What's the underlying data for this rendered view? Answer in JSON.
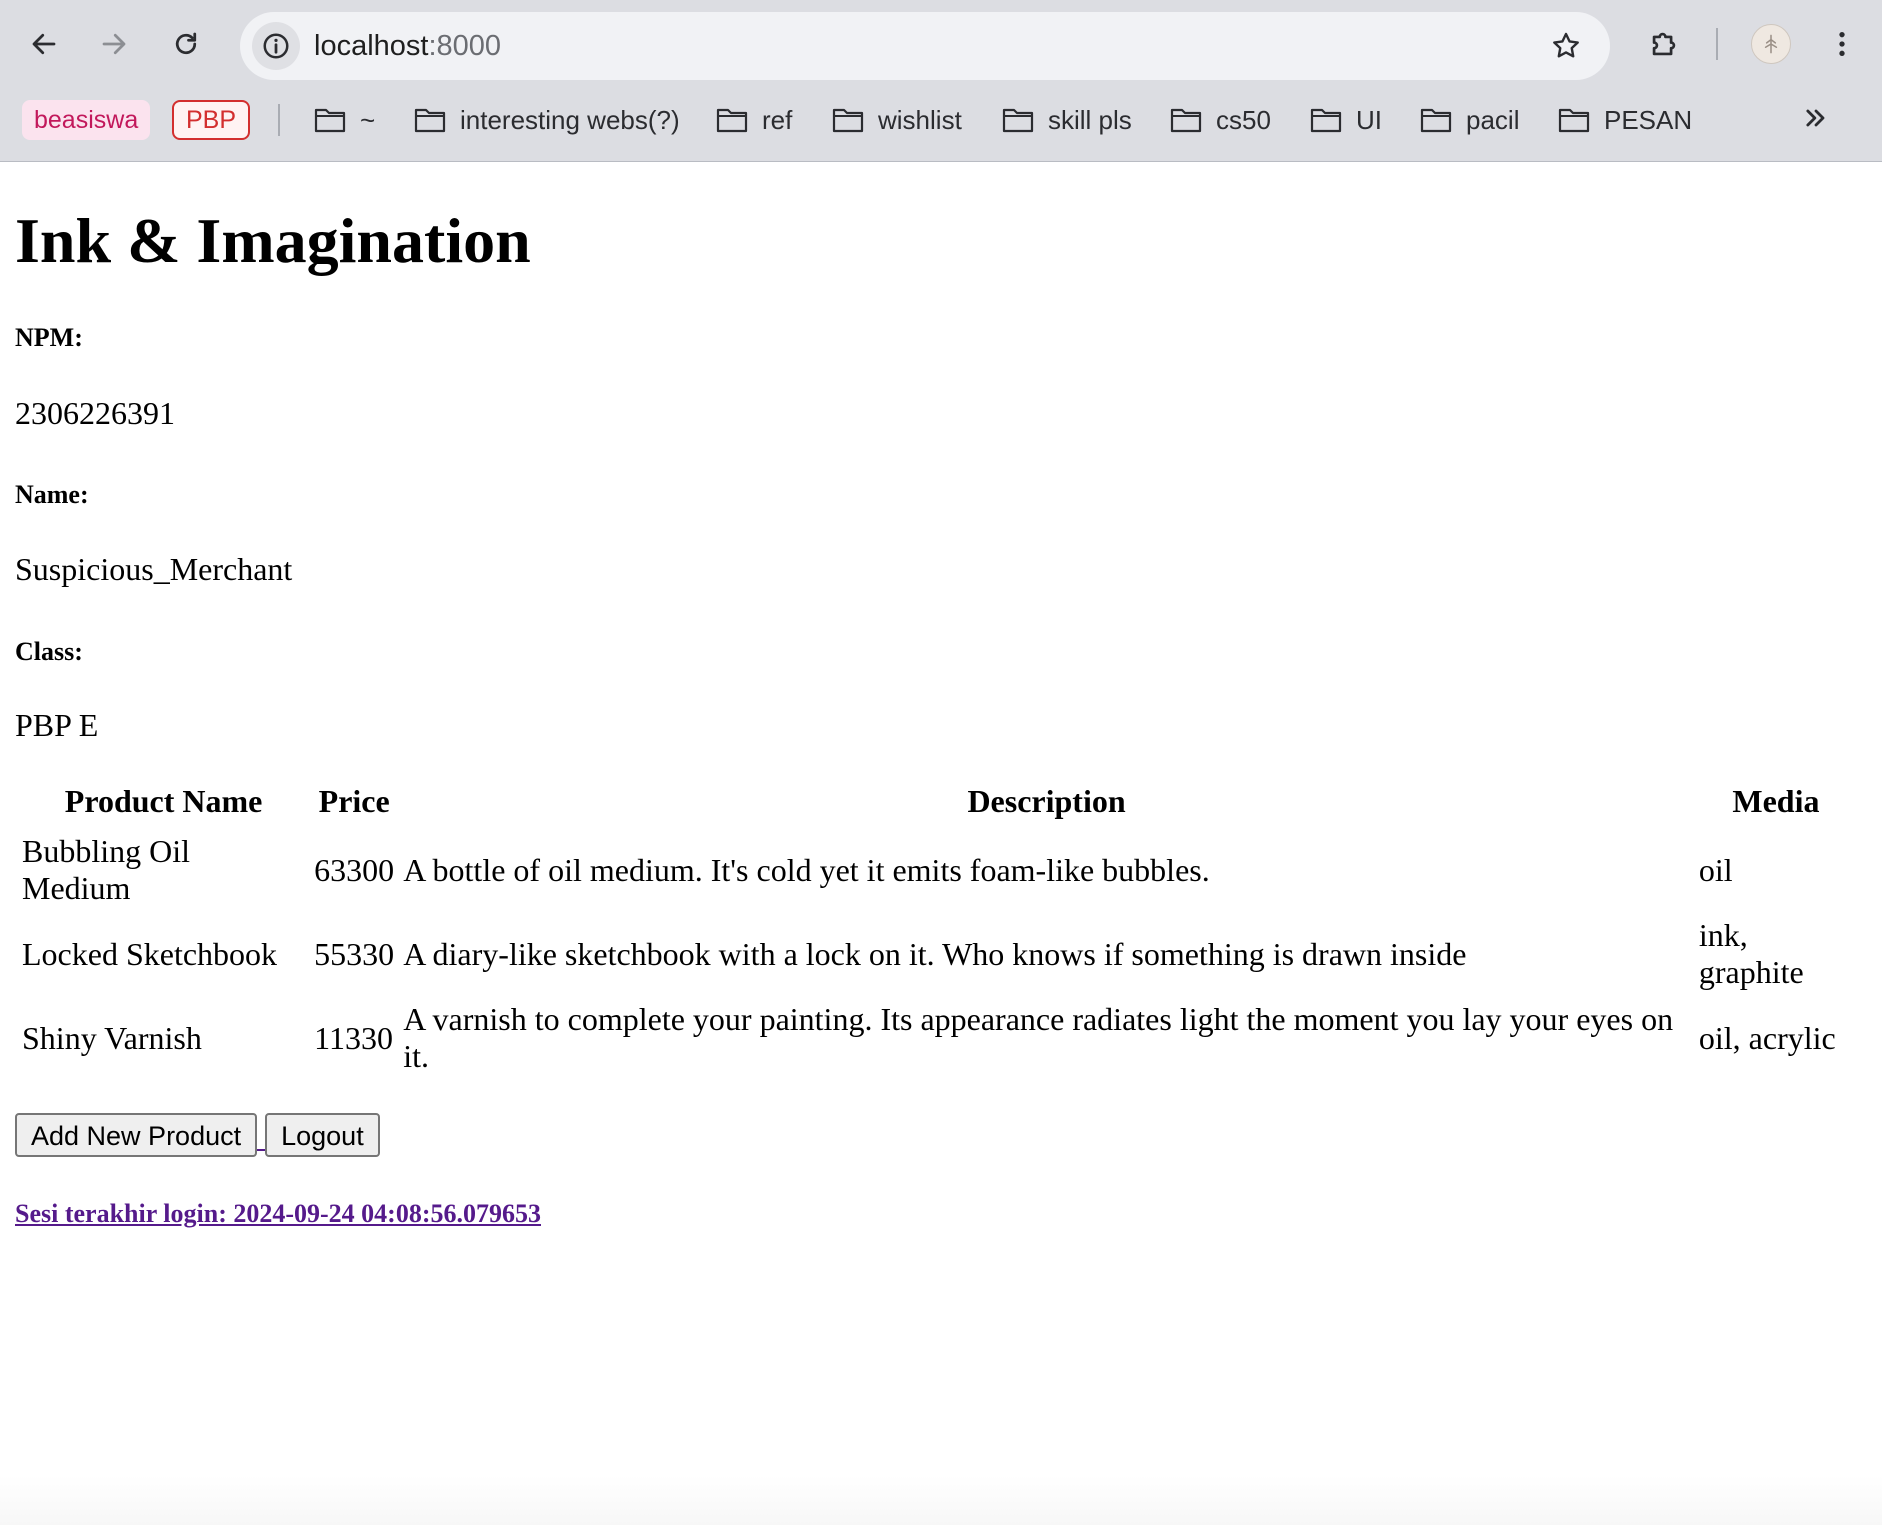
{
  "browser": {
    "url_host": "localhost",
    "url_port": ":8000",
    "bookmarks": {
      "chips": [
        {
          "label": "beasiswa",
          "color": "#c2185b"
        },
        {
          "label": "PBP",
          "color": "#d32f2f"
        }
      ],
      "folders": [
        {
          "label": "~"
        },
        {
          "label": "interesting webs(?)"
        },
        {
          "label": "ref"
        },
        {
          "label": "wishlist"
        },
        {
          "label": "skill pls"
        },
        {
          "label": "cs50"
        },
        {
          "label": "UI"
        },
        {
          "label": "pacil"
        },
        {
          "label": "PESAN"
        }
      ],
      "overflow_icon": "double-chevron-right-icon"
    },
    "icons": {
      "back": "arrow-left-icon",
      "forward": "arrow-right-icon",
      "reload": "reload-icon",
      "site_info": "info-icon",
      "bookmark_star": "star-icon",
      "extensions": "puzzle-icon",
      "menu": "kebab-menu-icon"
    }
  },
  "page": {
    "title": "Ink & Imagination",
    "npm_label": "NPM:",
    "npm_value": "2306226391",
    "name_label": "Name:",
    "name_value": "Suspicious_Merchant",
    "class_label": "Class:",
    "class_value": "PBP E",
    "table": {
      "headers": [
        "Product Name",
        "Price",
        "Description",
        "Media"
      ],
      "rows": [
        {
          "name": "Bubbling Oil Medium",
          "price": "63300",
          "description": "A bottle of oil medium. It's cold yet it emits foam-like bubbles.",
          "media": "oil"
        },
        {
          "name": "Locked Sketchbook",
          "price": "55330",
          "description": "A diary-like sketchbook with a lock on it. Who knows if something is drawn inside",
          "media": "ink, graphite"
        },
        {
          "name": "Shiny Varnish",
          "price": "11330",
          "description": "A varnish to complete your painting. Its appearance radiates light the moment you lay your eyes on it.",
          "media": "oil, acrylic"
        }
      ]
    },
    "add_button_label": "Add New Product",
    "logout_button_label": "Logout",
    "last_login_text": "Sesi terakhir login: 2024-09-24 04:08:56.079653",
    "link_color": "#551a8b"
  }
}
